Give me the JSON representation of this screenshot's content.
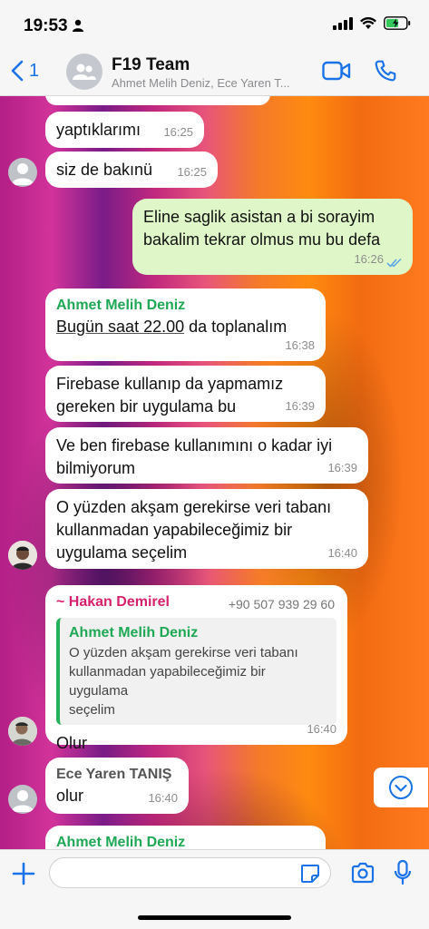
{
  "status": {
    "time": "19:53"
  },
  "header": {
    "back_count": "1",
    "title": "F19 Team",
    "subtitle": "Ahmet Melih Deniz, Ece Yaren T..."
  },
  "messages": [
    {
      "text": "yaptıklarımı",
      "time": "16:25"
    },
    {
      "text": "siz de bakınü",
      "time": "16:25"
    },
    {
      "text_line1": "Eline saglik asistan a bi sorayim",
      "text_line2": "bakalim tekrar olmus mu bu defa",
      "time": "16:26"
    },
    {
      "sender": "Ahmet Melih Deniz",
      "link_text": "Bugün saat 22.00",
      "text_rest": " da toplanalım",
      "time": "16:38"
    },
    {
      "text_line1": "Firebase kullanıp da yapmamız",
      "text_line2": "gereken bir uygulama bu",
      "time": "16:39"
    },
    {
      "text_line1": "Ve ben firebase kullanımını o kadar iyi",
      "text_line2": "bilmiyorum",
      "time": "16:39"
    },
    {
      "text_line1": "O yüzden akşam gerekirse veri tabanı",
      "text_line2": "kullanmadan yapabileceğimiz bir",
      "text_line3": "uygulama seçelim",
      "time": "16:40"
    },
    {
      "sender": "~ Hakan Demirel",
      "phone": "+90 507 939 29 60",
      "quote_sender": "Ahmet Melih Deniz",
      "quote_line1": "O yüzden akşam gerekirse veri tabanı",
      "quote_line2": "kullanmadan yapabileceğimiz bir uygulama",
      "quote_line3": "seçelim",
      "text": "Olur",
      "time": "16:40"
    },
    {
      "sender": "Ece Yaren TANIŞ",
      "text": "olur",
      "time": "16:40"
    },
    {
      "sender": "Ahmet Melih Deniz"
    }
  ],
  "composer": {
    "value": "",
    "placeholder": ""
  },
  "colors": {
    "accent": "#1a73e8",
    "outgoing": "#dff7c8",
    "sender_green": "#1fa855",
    "sender_red": "#d9206d"
  }
}
